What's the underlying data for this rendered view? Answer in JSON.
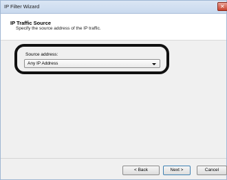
{
  "window": {
    "title": "IP Filter Wizard",
    "close_glyph": "✕",
    "close_icon": "close-icon"
  },
  "header": {
    "title": "IP Traffic Source",
    "subtitle": "Specify the source address of the IP traffic."
  },
  "form": {
    "source_label": "Source address:",
    "source_value": "Any IP Address"
  },
  "buttons": {
    "back": "< Back",
    "next": "Next >",
    "cancel": "Cancel"
  },
  "colors": {
    "close_button": "#c7432e",
    "highlight_ring": "#111111"
  }
}
